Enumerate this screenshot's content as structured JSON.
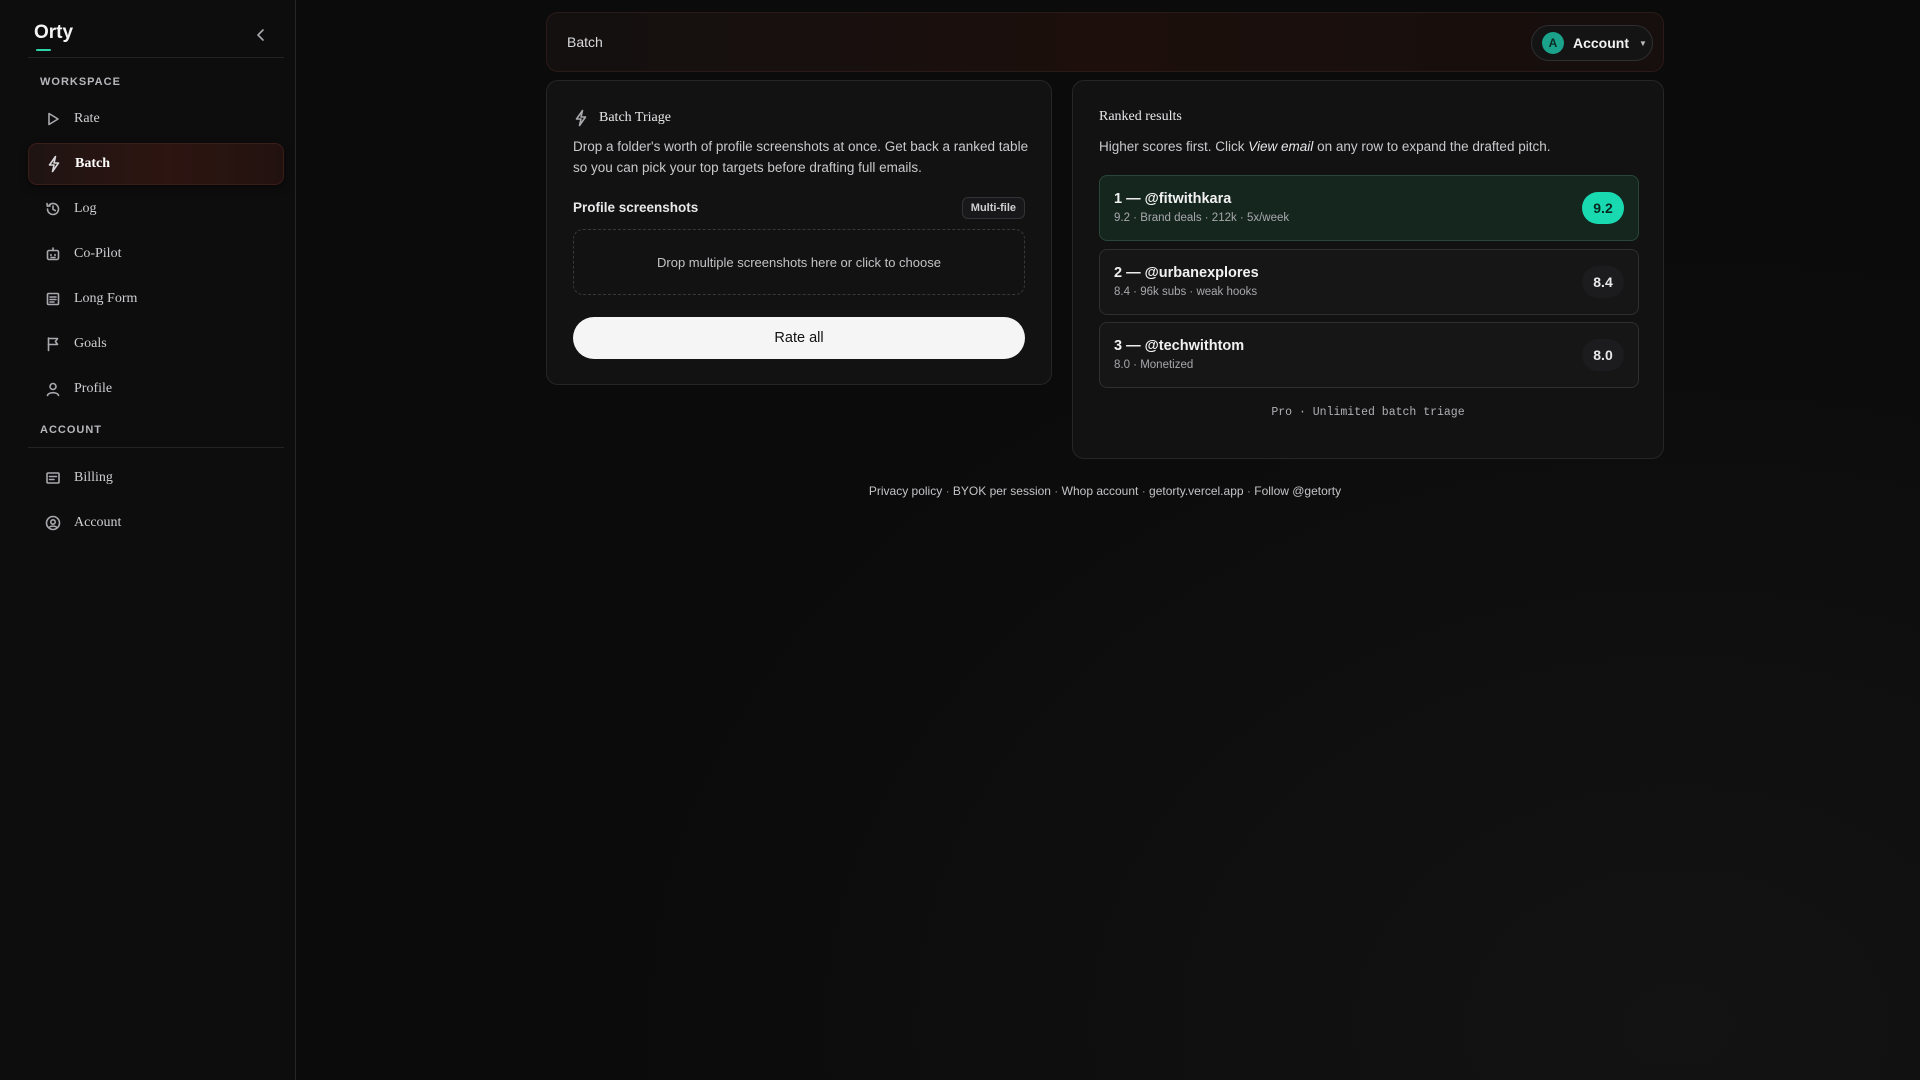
{
  "app": {
    "brand": "Orty",
    "accent": "#2dd4a8"
  },
  "sidebar": {
    "workspace_label": "WORKSPACE",
    "account_label": "ACCOUNT",
    "workspace_items": [
      {
        "label": "Rate",
        "icon": "play-icon"
      },
      {
        "label": "Batch",
        "icon": "lightning-icon",
        "active": true
      },
      {
        "label": "Log",
        "icon": "history-icon"
      },
      {
        "label": "Co-Pilot",
        "icon": "robot-icon"
      },
      {
        "label": "Long Form",
        "icon": "document-icon"
      },
      {
        "label": "Goals",
        "icon": "flag-icon"
      },
      {
        "label": "Profile",
        "icon": "user-icon"
      }
    ],
    "account_items": [
      {
        "label": "Billing",
        "icon": "billing-icon"
      },
      {
        "label": "Account",
        "icon": "account-circle-icon"
      }
    ]
  },
  "header": {
    "title": "Batch",
    "account_button": "Account",
    "avatar_letter": "A"
  },
  "batch_card": {
    "title": "Batch Triage",
    "description": "Drop a folder's worth of profile screenshots at once. Get back a ranked table so you can pick your top targets before drafting full emails.",
    "field_label": "Profile screenshots",
    "badge": "Multi-file",
    "dropzone_text": "Drop multiple screenshots here or click to choose",
    "button": "Rate all"
  },
  "results_card": {
    "title": "Ranked results",
    "description_before": "Higher scores first. Click ",
    "description_emphasis": "View email",
    "description_after": " on any row to expand the drafted pitch.",
    "rows": [
      {
        "name": "1 — @fitwithkara",
        "meta": "9.2 · Brand deals · 212k · 5x/week",
        "score": "9.2"
      },
      {
        "name": "2 — @urbanexplores",
        "meta": "8.4 · 96k subs · weak hooks",
        "score": "8.4"
      },
      {
        "name": "3 — @techwithtom",
        "meta": "8.0 · Monetized",
        "score": "8.0"
      }
    ],
    "plan_note": "Pro · Unlimited batch triage"
  },
  "footer": {
    "links": [
      "Privacy policy",
      "BYOK per session",
      "Whop account",
      "getorty.vercel.app",
      "Follow @getorty"
    ],
    "separator": "·"
  }
}
